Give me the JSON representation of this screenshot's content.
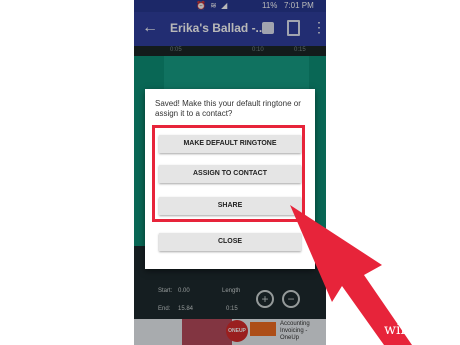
{
  "status": {
    "icons": "⏰ ≋ ◢",
    "battery": "11%",
    "time": "7:01 PM"
  },
  "appbar": {
    "title": "Erika's Ballad -..."
  },
  "timeline": {
    "ticks": [
      "0:05",
      "0:10",
      "0:15"
    ]
  },
  "controls": {
    "start_label": "Start:",
    "start_value": "0.00",
    "end_label": "End:",
    "end_value": "15.84",
    "length_label": "Length",
    "length_value": "0:15"
  },
  "ad": {
    "logo": "ONEUP",
    "text": "Accounting Invoicing - OneUp"
  },
  "dialog": {
    "message": "Saved! Make this your default ringtone or assign it to a contact?",
    "buttons": {
      "default": "MAKE DEFAULT RINGTONE",
      "contact": "ASSIGN TO CONTACT",
      "share": "SHARE",
      "close": "CLOSE"
    }
  },
  "watermark": "wikiHow",
  "colors": {
    "highlight": "#e7243a",
    "appbar": "#303f9f",
    "waveform": "#0d8f77"
  }
}
